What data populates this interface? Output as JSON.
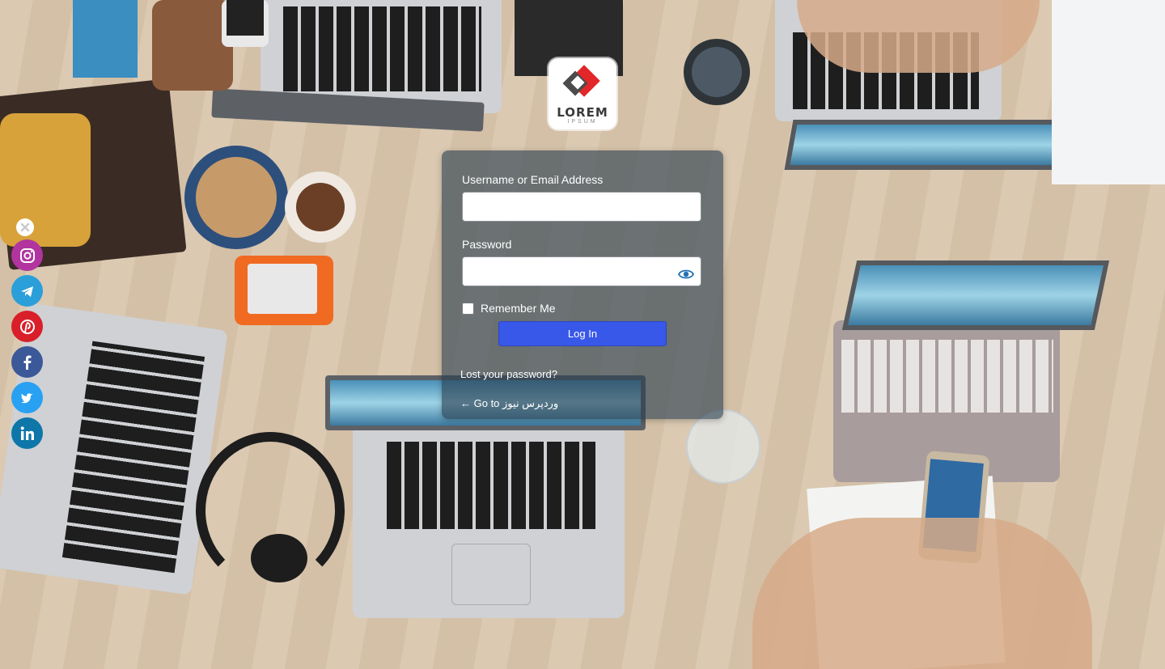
{
  "logo": {
    "brand": "LOREM",
    "tagline": "IPSUM",
    "accent_red": "#e2262a",
    "accent_dark": "#4b4b4b"
  },
  "login": {
    "username_label": "Username or Email Address",
    "username_value": "",
    "password_label": "Password",
    "password_value": "",
    "show_password_icon": "eye-icon",
    "remember_label": "Remember Me",
    "remember_checked": false,
    "submit_label": "Log In",
    "lost_password_link": "Lost your password?",
    "back_link": "← Go to وردپرس نیوز",
    "button_color": "#3858e9"
  },
  "social": {
    "close_icon": "close-icon",
    "items": [
      {
        "name": "instagram",
        "icon": "instagram-icon",
        "color": "#b1349f"
      },
      {
        "name": "telegram",
        "icon": "telegram-icon",
        "color": "#2b9fd9"
      },
      {
        "name": "pinterest",
        "icon": "pinterest-icon",
        "color": "#d81f2a"
      },
      {
        "name": "facebook",
        "icon": "facebook-icon",
        "color": "#3b5998"
      },
      {
        "name": "twitter",
        "icon": "twitter-icon",
        "color": "#29a1f2"
      },
      {
        "name": "linkedin",
        "icon": "linkedin-icon",
        "color": "#0e76a8"
      }
    ]
  }
}
